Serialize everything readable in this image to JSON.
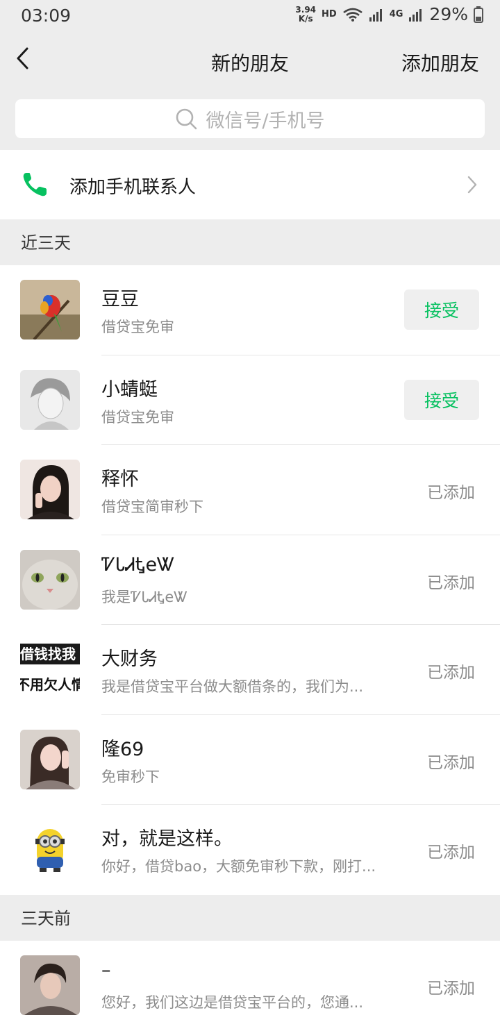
{
  "status_bar": {
    "time": "03:09",
    "net_speed_value": "3.94",
    "net_speed_unit": "K/s",
    "hd": "HD",
    "signal_label": "4G",
    "battery": "29%"
  },
  "nav": {
    "back_icon": "chevron-left-icon",
    "title": "新的朋友",
    "action": "添加朋友"
  },
  "search": {
    "icon": "search-icon",
    "placeholder": "微信号/手机号"
  },
  "phone_contacts": {
    "icon": "phone-icon",
    "label": "添加手机联系人",
    "accent": "#07c160"
  },
  "sections": {
    "recent": "近三天",
    "older": "三天前"
  },
  "recent_items": [
    {
      "name": "豆豆",
      "message": "借贷宝免审",
      "status": "接受",
      "type": "accept"
    },
    {
      "name": "小蜻蜓",
      "message": "借贷宝免审",
      "status": "接受",
      "type": "accept"
    },
    {
      "name": "释怀",
      "message": "借贷宝简审秒下",
      "status": "已添加",
      "type": "added"
    },
    {
      "name": "ᏤᏓᏗᎿеᏔ",
      "message": "我是ᏤᏓᏗᎿеᏔ",
      "status": "已添加",
      "type": "added"
    },
    {
      "name": "大财务",
      "message": "我是借贷宝平台做大额借条的，我们为...",
      "status": "已添加",
      "type": "added",
      "avatar_text_top": "借钱找我",
      "avatar_text_bottom": "不用欠人情"
    },
    {
      "name": "隆69",
      "message": "免审秒下",
      "status": "已添加",
      "type": "added"
    },
    {
      "name": "对，就是这样。",
      "message": "你好，借贷bao，大额免审秒下款，刚打...",
      "status": "已添加",
      "type": "added"
    }
  ],
  "older_items": [
    {
      "name": "–",
      "message": "您好，我们这边是借贷宝平台的，您通...",
      "status": "已添加",
      "type": "added"
    }
  ],
  "colors": {
    "background": "#ededed",
    "accent": "#07c160",
    "button_bg": "#efefef"
  }
}
